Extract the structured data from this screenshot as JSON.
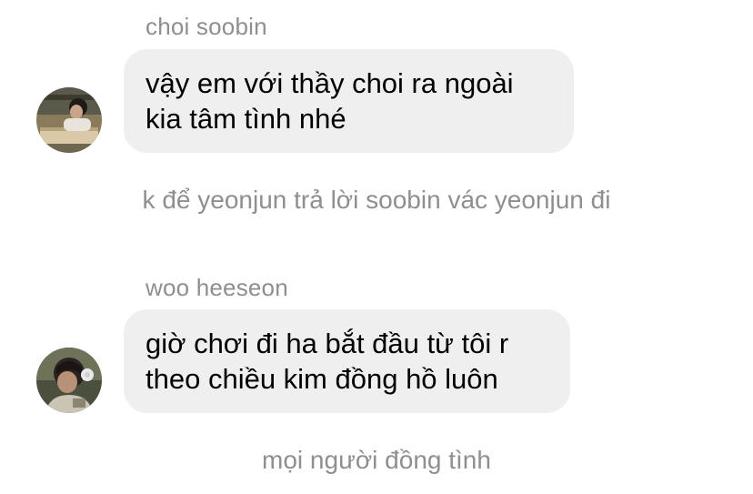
{
  "messages": [
    {
      "sender": "choi soobin",
      "avatar_icon": "user-photo-icon",
      "lines": [
        "vậy em với thầy choi ra ngoài",
        "kia tâm tình nhé"
      ]
    },
    {
      "sender": "woo heeseon",
      "avatar_icon": "user-photo-icon",
      "lines": [
        "giờ chơi đi ha bắt đầu từ tôi r",
        "theo chiều kim đồng hồ luôn"
      ]
    }
  ],
  "system_messages": [
    "k để yeonjun trả lời soobin vác yeonjun đi",
    "mọi người đồng tình"
  ],
  "colors": {
    "bubble_bg": "#efefef",
    "meta_text": "#8e8e93",
    "message_text": "#000000"
  }
}
